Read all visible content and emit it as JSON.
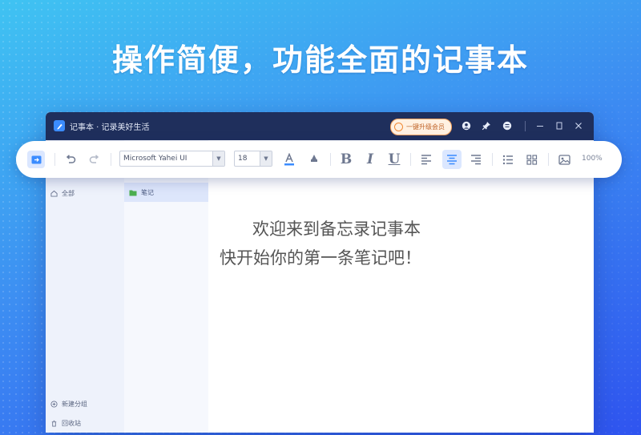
{
  "headline": "操作简便，功能全面的记事本",
  "window": {
    "title": "记事本 · 记录美好生活",
    "vip_label": "一键升级会员",
    "icons": [
      "user-icon",
      "pin-icon",
      "menu-icon",
      "minimize-icon",
      "maximize-icon",
      "close-icon"
    ]
  },
  "toolbar": {
    "font_family": "Microsoft Yahei UI",
    "font_size": "18",
    "zoom": "100%",
    "bold": "B",
    "italic": "I",
    "underline": "U"
  },
  "sidebar": {
    "top_item": "全部",
    "bottom_items": [
      "新建分组",
      "回收站"
    ]
  },
  "notelist": {
    "active_item": "笔记"
  },
  "editor": {
    "welcome_line1": "欢迎来到备忘录记事本",
    "welcome_line2": "快开始你的第一条笔记吧！"
  },
  "colors": {
    "accent": "#3b8cff",
    "titlebar": "#1f2f5c",
    "vip": "#f08a35"
  }
}
